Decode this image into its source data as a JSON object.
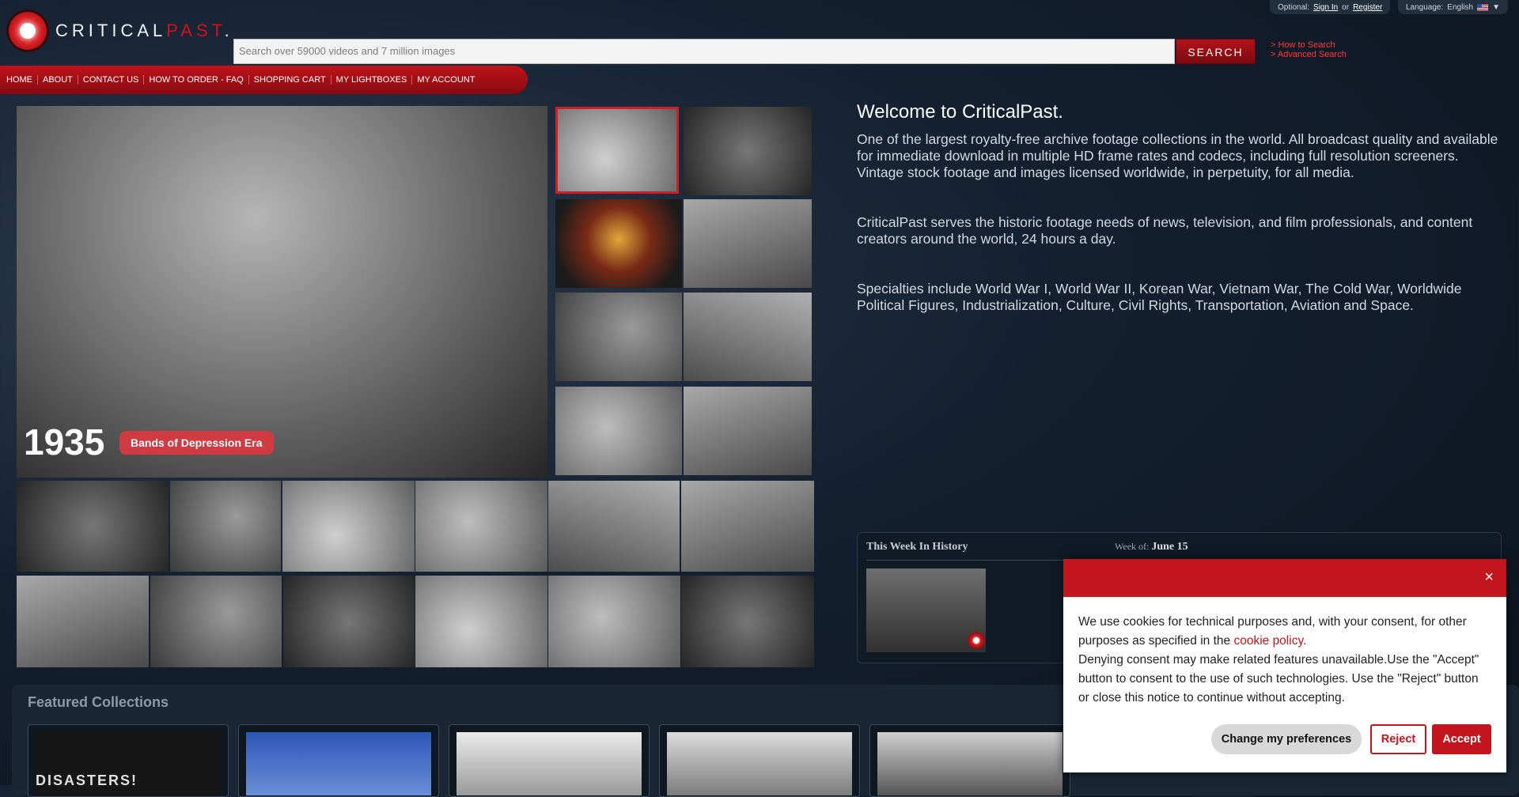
{
  "header": {
    "logo_main": "CRITICAL",
    "logo_accent": "PAST",
    "search_placeholder": "Search over 59000 videos and 7 million images",
    "search_button": "SEARCH",
    "search_links": [
      "> How to Search",
      "> Advanced Search"
    ],
    "optional_label": "Optional:",
    "sign_in": "Sign In",
    "or": "or",
    "register": "Register",
    "language_label": "Language:",
    "language_value": "English",
    "language_caret": "▼"
  },
  "nav": {
    "items": [
      "HOME",
      "ABOUT",
      "CONTACT US",
      "HOW TO ORDER - FAQ",
      "SHOPPING CART",
      "MY LIGHTBOXES",
      "MY ACCOUNT"
    ]
  },
  "hero": {
    "year": "1935",
    "tag": "Bands of Depression Era"
  },
  "welcome": {
    "title": "Welcome to CriticalPast.",
    "paragraphs": [
      "One of the largest royalty-free archive footage collections in the world. All broadcast quality and available for immediate download in multiple HD frame rates and codecs, including full resolution screeners. Vintage stock footage and images licensed worldwide, in perpetuity, for all media.",
      "CriticalPast serves the historic footage needs of news, television, and film professionals, and content creators around the world, 24 hours a day.",
      "Specialties include World War I, World War II, Korean War, Vietnam War, The Cold War, Worldwide Political Figures, Industrialization, Culture, Civil Rights, Transportation, Aviation and Space."
    ]
  },
  "week": {
    "title": "This Week In History",
    "week_of_label": "Week of:",
    "week_of_value": "June 15"
  },
  "featured": {
    "title": "Featured Collections",
    "first_card_text": "DISASTERS!"
  },
  "cookie": {
    "close": "×",
    "text1": "We use cookies for technical purposes and, with your consent, for other purposes as specified in the ",
    "link": "cookie policy.",
    "text2": "Denying consent may make related features unavailable.Use the \"Accept\" button to consent to the use of such technologies. Use the \"Reject\" button or close this notice to continue without accepting.",
    "btn_pref": "Change my preferences",
    "btn_reject": "Reject",
    "btn_accept": "Accept"
  }
}
